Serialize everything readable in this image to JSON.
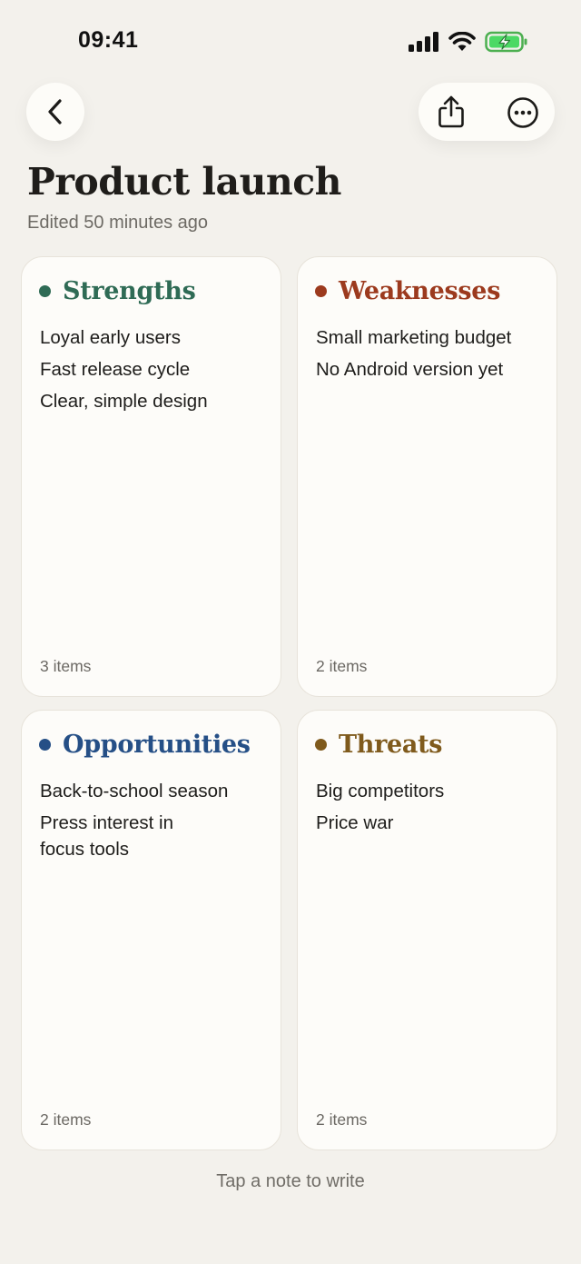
{
  "status_bar": {
    "time": "09:41"
  },
  "nav": {
    "back_icon": "chevron-left-icon",
    "share_icon": "share-icon",
    "more_icon": "more-icon"
  },
  "header": {
    "title": "Product launch",
    "subtitle": "Edited 50 minutes ago"
  },
  "quadrants": [
    {
      "title": "Strengths",
      "color": "#2f6b55",
      "items": [
        "Loyal early users",
        "Fast release cycle",
        "Clear, simple design"
      ],
      "count": "3 items"
    },
    {
      "title": "Weaknesses",
      "color": "#9c3a1e",
      "items": [
        "Small marketing budget",
        "No Android version yet"
      ],
      "count": "2 items"
    },
    {
      "title": "Opportunities",
      "color": "#254f86",
      "items": [
        "Back-to-school season",
        "Press interest in focus tools"
      ],
      "count": "2 items"
    },
    {
      "title": "Threats",
      "color": "#7f5a1c",
      "items": [
        "Big competitors",
        "Price war"
      ],
      "count": "2 items"
    }
  ],
  "footer": {
    "hint": "Tap a note to write"
  }
}
